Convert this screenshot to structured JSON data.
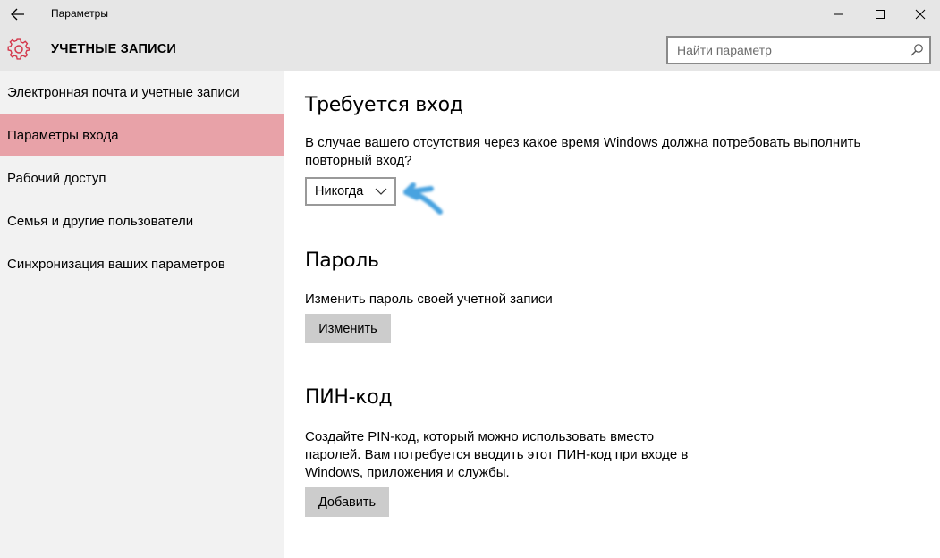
{
  "window": {
    "title": "Параметры"
  },
  "header": {
    "title": "УЧЕТНЫЕ ЗАПИСИ",
    "search_placeholder": "Найти параметр"
  },
  "sidebar": {
    "items": [
      {
        "label": "Электронная почта и учетные записи",
        "active": false
      },
      {
        "label": "Параметры входа",
        "active": true
      },
      {
        "label": "Рабочий доступ",
        "active": false
      },
      {
        "label": "Семья и другие пользователи",
        "active": false
      },
      {
        "label": "Синхронизация ваших параметров",
        "active": false
      }
    ]
  },
  "signin": {
    "heading": "Требуется вход",
    "description": "В случае вашего отсутствия через какое время Windows должна потребовать выполнить повторный вход?",
    "dropdown_value": "Никогда"
  },
  "password": {
    "heading": "Пароль",
    "description": "Изменить пароль своей учетной записи",
    "button": "Изменить"
  },
  "pin": {
    "heading": "ПИН-код",
    "description": "Создайте PIN-код, который можно использовать вместо паролей. Вам потребуется вводить этот ПИН-код при входе в Windows, приложения и службы.",
    "button": "Добавить"
  },
  "colors": {
    "accent": "#e8a2a8",
    "gear": "#d4364a",
    "annotation_arrow": "#4aa3e0"
  }
}
